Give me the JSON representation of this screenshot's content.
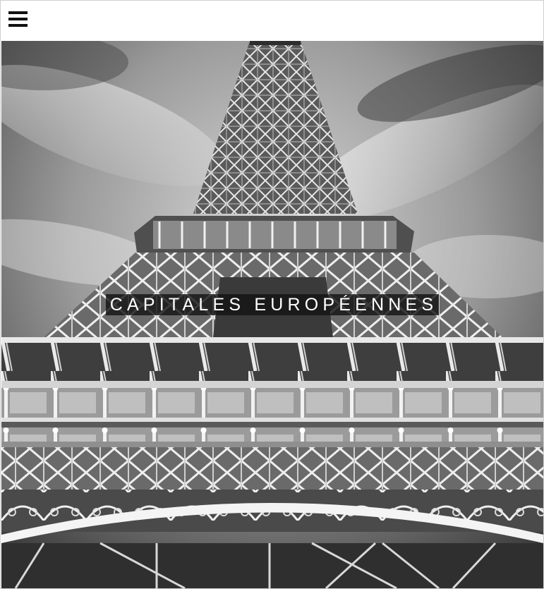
{
  "header": {
    "menu_icon": "hamburger-menu-icon"
  },
  "hero": {
    "image_subject": "eiffel-tower-black-and-white",
    "title": "CAPITALES EUROPÉENNES"
  },
  "colors": {
    "page_background": "#ffffff",
    "menu_icon": "#111111",
    "title_background": "#141414",
    "title_text": "#ffffff"
  }
}
